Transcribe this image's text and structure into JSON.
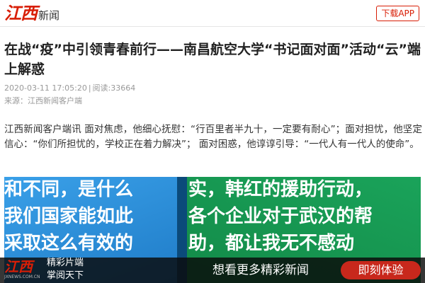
{
  "header": {
    "logo_mark": "江西",
    "logo_text": "新闻",
    "download_label": "下载APP"
  },
  "article": {
    "title": "在战“疫”中引领青春前行——南昌航空大学“书记面对面”活动“云”端上解惑",
    "date": "2020-03-11 17:05:20",
    "views": "阅读:33664",
    "source": "来源：江西新闻客户端",
    "lead": "江西新闻客户端讯  面对焦虑，他细心抚慰：“行百里者半九十，一定要有耐心”；面对担忧，他坚定信心：“你们所担忧的，学校正在着力解决”；  面对困惑，他谆谆引导：“一代人有一代人的使命”。"
  },
  "photo": {
    "left_lines": [
      "和不同，是什么",
      "我们国家能如此",
      "采取这么有效的"
    ],
    "right_lines": [
      "实，韩红的援助行动，",
      "各个企业对于武汉的帮",
      "助，都让我无不感动"
    ]
  },
  "banner": {
    "logo_mark": "江西",
    "logo_sub": "JXNEWS.COM.CN",
    "line1": "精彩片端",
    "line2": "掌阅天下",
    "cta_text": "想看更多精彩新闻",
    "cta_button": "即刻体验"
  },
  "colors": {
    "brand_red": "#d81e06",
    "cta_red": "#c8281c"
  }
}
